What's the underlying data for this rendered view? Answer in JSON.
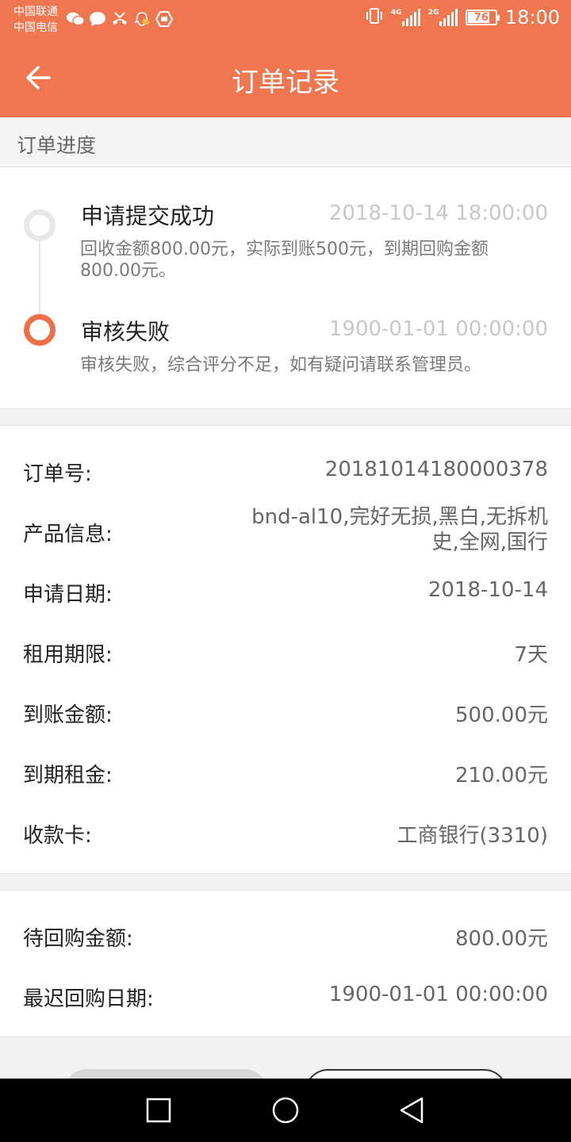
{
  "status_bar": {
    "carrier1": "中国联通",
    "carrier2": "中国电信",
    "net1": "4G",
    "net2": "2G",
    "battery": "76",
    "battery_level": 0.76,
    "time": "18:00"
  },
  "header": {
    "title": "订单记录",
    "background": "#f07650"
  },
  "section_title": "订单进度",
  "timeline": [
    {
      "title": "申请提交成功",
      "time": "2018-10-14 18:00:00",
      "desc": "回收金额800.00元，实际到账500元，到期回购金额800.00元。"
    },
    {
      "title": "审核失败",
      "time": "1900-01-01 00:00:00",
      "desc": "审核失败，综合评分不足，如有疑问请联系管理员。"
    }
  ],
  "details": [
    {
      "label": "订单号:",
      "value": "20181014180000378"
    },
    {
      "label": "产品信息:",
      "value": "bnd-al10,完好无损,黑白,无拆机史,全网,国行"
    },
    {
      "label": "申请日期:",
      "value": "2018-10-14"
    },
    {
      "label": "租用期限:",
      "value": "7天"
    },
    {
      "label": "到账金额:",
      "value": "500.00元"
    },
    {
      "label": "到期租金:",
      "value": "210.00元"
    },
    {
      "label": "收款卡:",
      "value": "工商银行(3310)"
    }
  ],
  "details2": [
    {
      "label": "待回购金额:",
      "value": "800.00元"
    },
    {
      "label": "最迟回购日期:",
      "value": "1900-01-01 00:00:00"
    }
  ],
  "accent": "#ef6d47"
}
